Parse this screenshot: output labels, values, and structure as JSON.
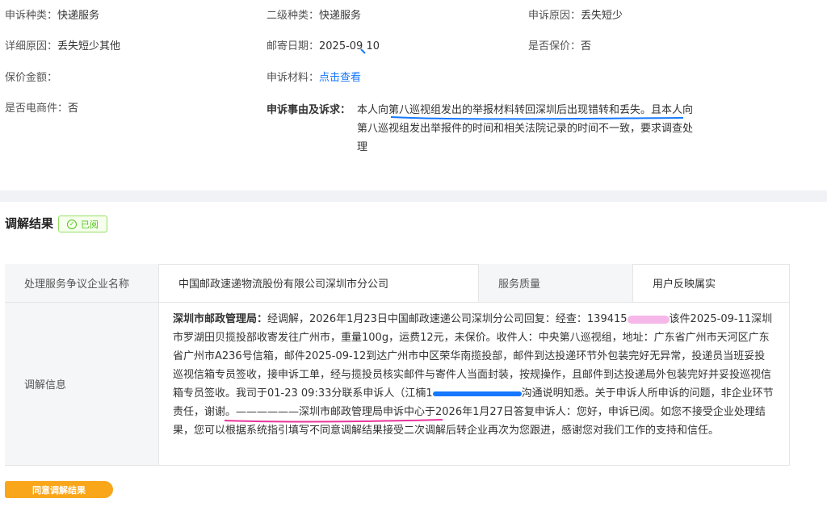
{
  "details": {
    "complaint_type": {
      "label": "申诉种类：",
      "value": "快递服务"
    },
    "secondary_type": {
      "label": "二级种类：",
      "value": "快递服务"
    },
    "complaint_reason": {
      "label": "申诉原因：",
      "value": "丢失短少"
    },
    "detailed_reason": {
      "label": "详细原因：",
      "value": "丢失短少其他"
    },
    "mail_date": {
      "label": "邮寄日期：",
      "value": "2025-09 10"
    },
    "insured": {
      "label": "是否保价：",
      "value": "否"
    },
    "insured_amount": {
      "label": "保价金额：",
      "value": ""
    },
    "materials": {
      "label": "申诉材料：",
      "link": "点击查看"
    },
    "ecommerce": {
      "label": "是否电商件：",
      "value": "否"
    },
    "claim": {
      "label": "申诉事由及诉求：",
      "text": "本人向第八巡视组发出的举报材料转回深圳后出现错转和丢失。且本人向第八巡视组发出举报件的时间和相关法院记录的时间不一致，要求调查处理"
    }
  },
  "mediation": {
    "title": "调解结果",
    "badge": "已阅",
    "table": {
      "company_header": "处理服务争议企业名称",
      "company_value": "中国邮政速递物流股份有限公司深圳市分公司",
      "quality_header": "服务质量",
      "quality_value": "用户反映属实",
      "info_header": "调解信息",
      "info_lead": "深圳市邮政管理局：",
      "info_part1": "经调解，2026年1月23日中国邮政速递公司深圳分公司回复：经查：139415",
      "info_part2": "该件2025-09-11深圳市罗湖田贝揽投部收寄发往广州市，重量100g，运费12元，未保价。收件人：中央第八巡视组，地址：广东省广州市天河区广东省广州市A236号信箱，邮件2025-09-12到达广州市中区荣华南揽投部，邮件到达投递环节外包装完好无异常，投递员当班妥投巡视信箱专员签收，接申诉工单，经与揽投员核实邮件与寄件人当面封装，按规操作，且邮件到达投递局外包装完好并妥投巡视信箱专员签收。我司于01-23 09:33分联系申诉人（江楠1",
      "info_part3": "沟通说明知悉。关于申诉人所申诉的问题，非企业环节责任，谢谢。——————深圳市邮政管理局申诉中心于2026年1月27日答复申诉人：您好，申诉已阅。如您不接受企业处理结果，您可以根据系统指引填写不同意调解结果接受二次调解后转企业再次为您跟进，感谢您对我们工作的支持和信任。"
    },
    "agree_button": "同意调解结果"
  },
  "colors": {
    "link": "#1677ff",
    "badge_green": "#52c41a",
    "button_orange": "#faa61a",
    "annotation_blue": "#1677ff",
    "annotation_pink": "#e8359a"
  }
}
